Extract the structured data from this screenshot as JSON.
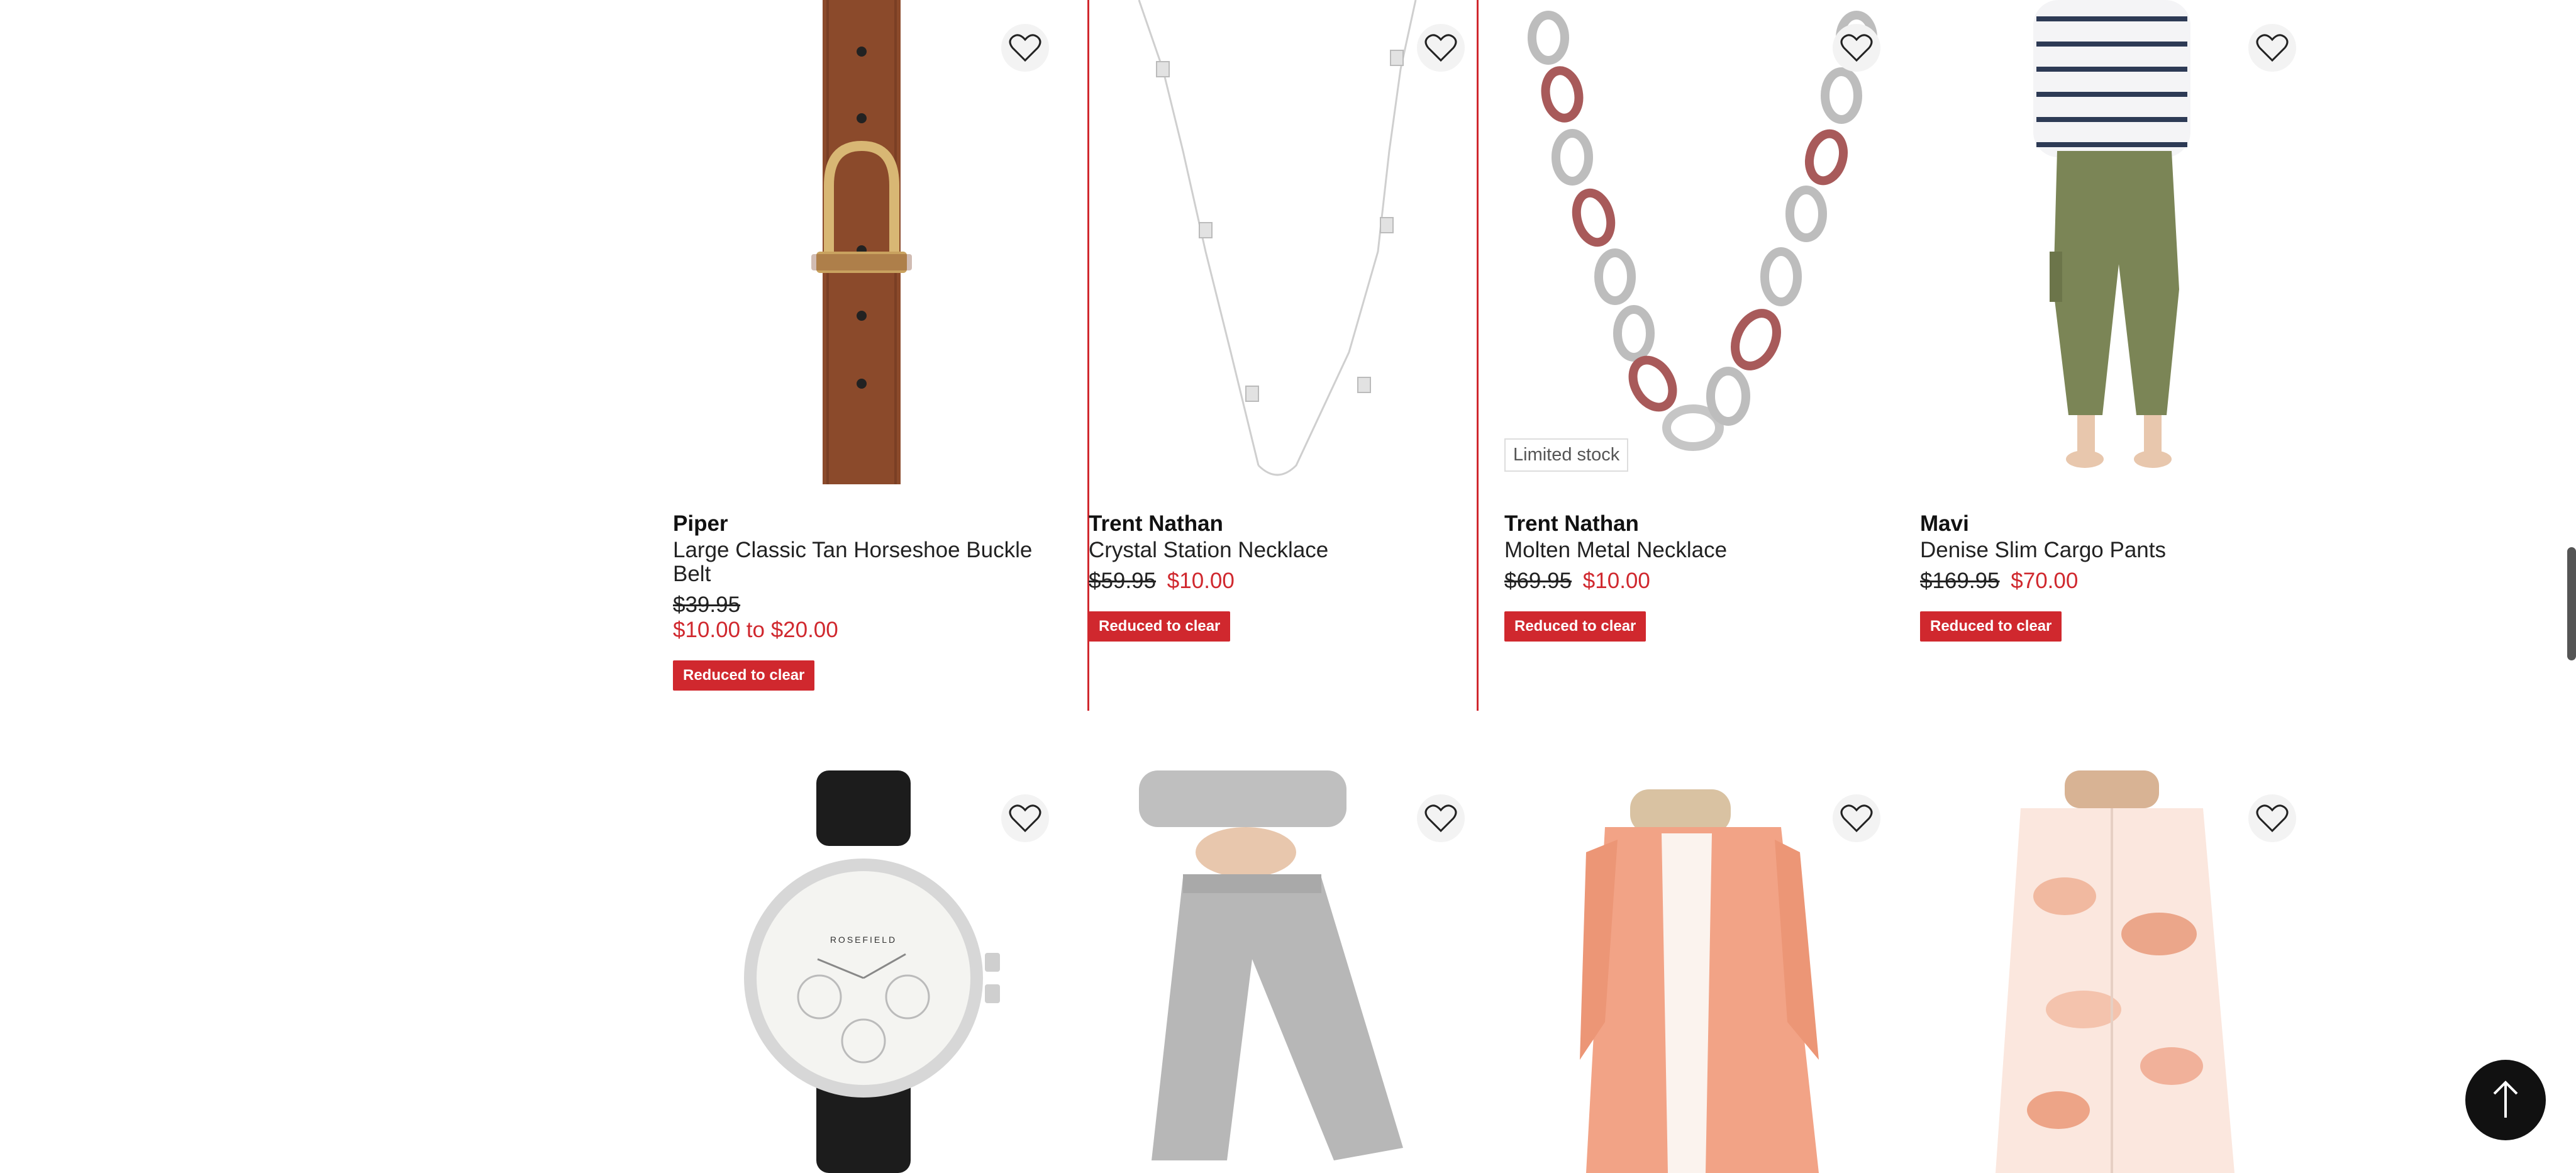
{
  "row1": [
    {
      "brand": "Piper",
      "name": "Large Classic Tan Horseshoe Buckle Belt",
      "was": "$39.95",
      "now": "$10.00 to $20.00",
      "badge": "Reduced to clear",
      "image": "brown leather belt with gold horseshoe buckle"
    },
    {
      "brand": "Trent Nathan",
      "name": "Crystal Station Necklace",
      "was": "$59.95",
      "now": "$10.00",
      "badge": "Reduced to clear",
      "image": "thin silver chain necklace with crystal stations"
    },
    {
      "brand": "Trent Nathan",
      "name": "Molten Metal Necklace",
      "was": "$69.95",
      "now": "$10.00",
      "badge": "Reduced to clear",
      "limited": "Limited stock",
      "image": "silver and burgundy oval chain link necklace"
    },
    {
      "brand": "Mavi",
      "name": "Denise Slim Cargo Pants",
      "was": "$169.95",
      "now": "$70.00",
      "badge": "Reduced to clear",
      "image": "model in striped top and khaki cargo pants"
    }
  ],
  "row2": [
    {
      "image": "silver chronograph watch with black leather strap",
      "watch_brand": "ROSEFIELD"
    },
    {
      "image": "model in grey knit cropped wide-leg pants"
    },
    {
      "image": "model in coral linen shirt"
    },
    {
      "image": "model in peach watercolour print longline shirt"
    }
  ],
  "colors": {
    "accent": "#d0282e",
    "belt": "#8b4a2b",
    "khaki": "#7b8556"
  },
  "icons": {
    "wishlist": "heart-outline-icon",
    "back_to_top": "arrow-up-icon"
  }
}
